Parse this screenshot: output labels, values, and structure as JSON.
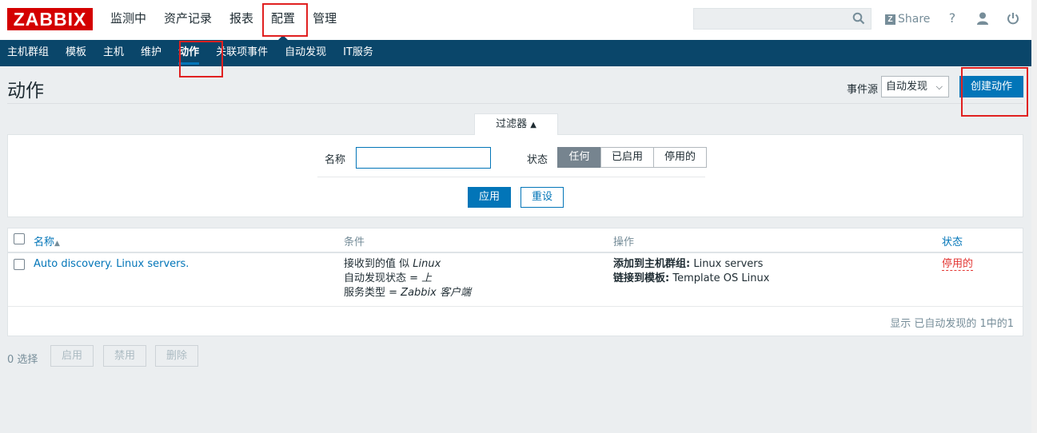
{
  "header": {
    "logo": "ZABBIX",
    "menu": [
      "监测中",
      "资产记录",
      "报表",
      "配置",
      "管理"
    ],
    "active_menu": "配置",
    "share_label": "Share",
    "help_label": "?"
  },
  "subnav": {
    "items": [
      "主机群组",
      "模板",
      "主机",
      "维护",
      "动作",
      "关联项事件",
      "自动发现",
      "IT服务"
    ],
    "active": "动作"
  },
  "page": {
    "title": "动作",
    "event_source_label": "事件源",
    "event_source_value": "自动发现",
    "create_button": "创建动作"
  },
  "filter": {
    "tab_label": "过滤器",
    "name_label": "名称",
    "name_value": "",
    "status_label": "状态",
    "status_options": [
      "任何",
      "已启用",
      "停用的"
    ],
    "status_selected": "任何",
    "apply_label": "应用",
    "reset_label": "重设"
  },
  "table": {
    "headers": {
      "name": "名称",
      "conditions": "条件",
      "operations": "操作",
      "status": "状态"
    },
    "rows": [
      {
        "name": "Auto discovery. Linux servers.",
        "conditions": [
          {
            "label": "接收到的值 似 ",
            "value": "Linux"
          },
          {
            "label": "自动发现状态 = ",
            "value": "上"
          },
          {
            "label": "服务类型 = ",
            "value": "Zabbix 客户端"
          }
        ],
        "operations": [
          {
            "label": "添加到主机群组:",
            "value": " Linux servers"
          },
          {
            "label": "链接到模板:",
            "value": " Template OS Linux"
          }
        ],
        "status": "停用的"
      }
    ],
    "footer": "显示 已自动发现的 1中的1"
  },
  "bulk": {
    "selected": "0 选择",
    "enable_label": "启用",
    "disable_label": "禁用",
    "delete_label": "删除"
  }
}
